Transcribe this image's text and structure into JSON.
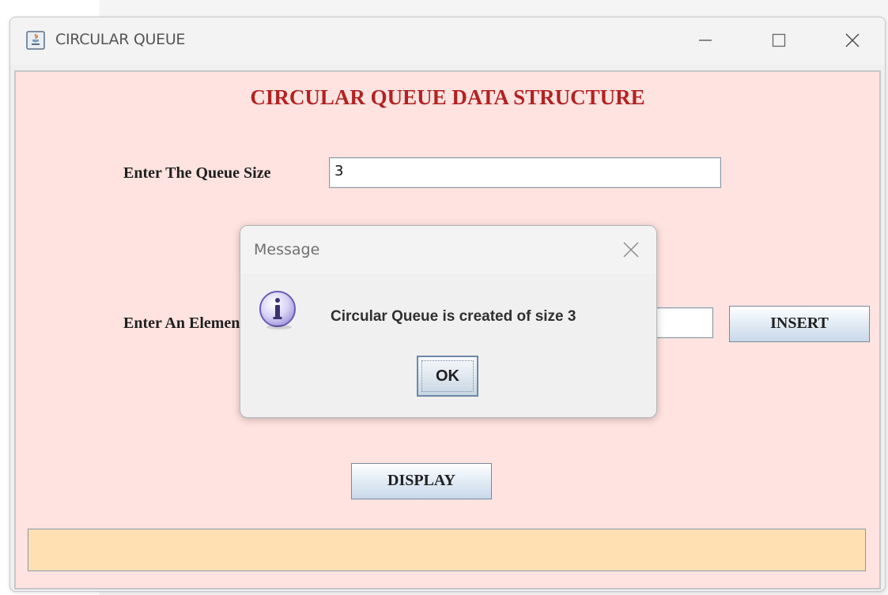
{
  "window": {
    "title": "CIRCULAR QUEUE"
  },
  "main": {
    "heading": "CIRCULAR QUEUE DATA STRUCTURE",
    "queue_size_label": "Enter The Queue Size",
    "queue_size_value": "3",
    "element_label": "Enter An Element",
    "element_value": "",
    "insert_label": "INSERT",
    "display_label": "DISPLAY",
    "status_text": ""
  },
  "dialog": {
    "title": "Message",
    "message": "Circular Queue is created of size 3",
    "ok_label": "OK",
    "icon": "information-icon"
  },
  "colors": {
    "client_background": "#ffe3e0",
    "heading": "#b22222",
    "status_bar": "#ffe0b3"
  }
}
